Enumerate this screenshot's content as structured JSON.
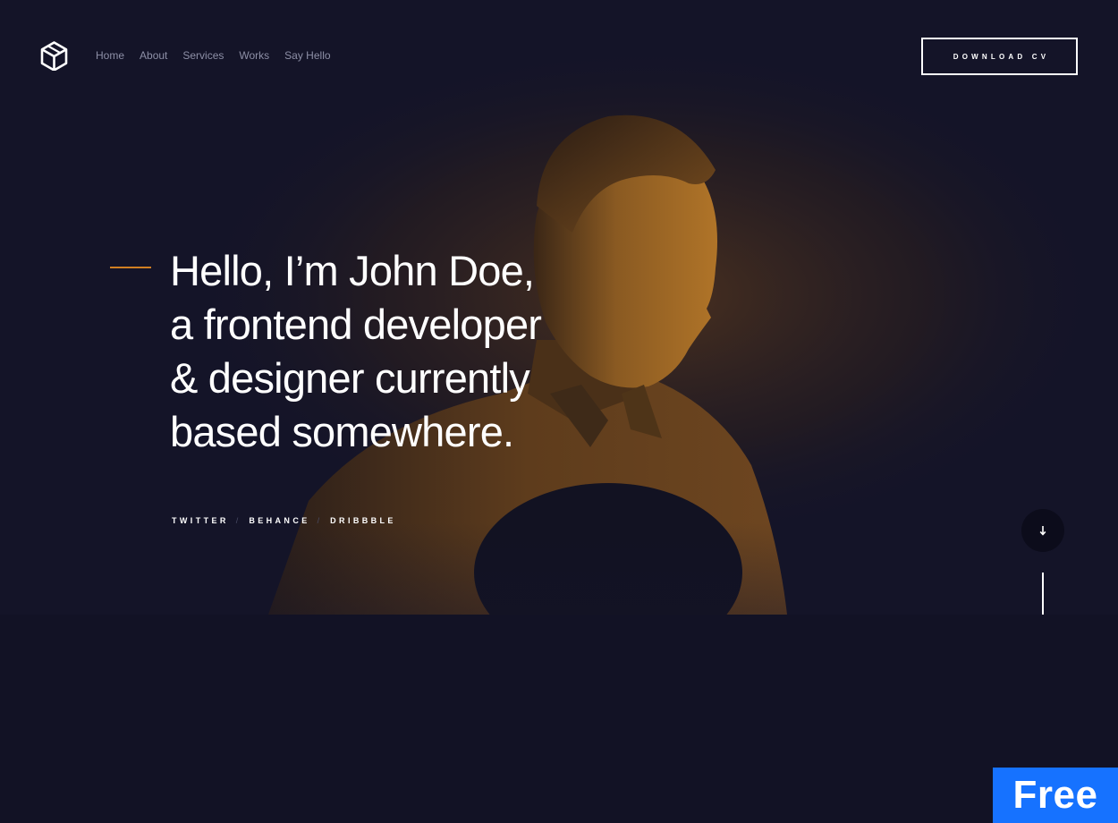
{
  "header": {
    "logo_icon": "hexagon-cube-logo",
    "nav": [
      {
        "label": "Home"
      },
      {
        "label": "About"
      },
      {
        "label": "Services"
      },
      {
        "label": "Works"
      },
      {
        "label": "Say Hello"
      }
    ],
    "cta_label": "DOWNLOAD CV"
  },
  "hero": {
    "headline": [
      "Hello, I’m John Doe,",
      "a frontend developer",
      "& designer currently",
      "based somewhere."
    ],
    "social": [
      {
        "label": "TWITTER"
      },
      {
        "label": "BEHANCE"
      },
      {
        "label": "DRIBBBLE"
      }
    ],
    "social_separator": "/",
    "scroll_icon": "arrow-down-icon"
  },
  "badge": {
    "label": "Free"
  },
  "colors": {
    "background": "#121225",
    "accent": "#d07f22",
    "badge": "#1672ff",
    "nav_text": "#8d8fa6"
  }
}
